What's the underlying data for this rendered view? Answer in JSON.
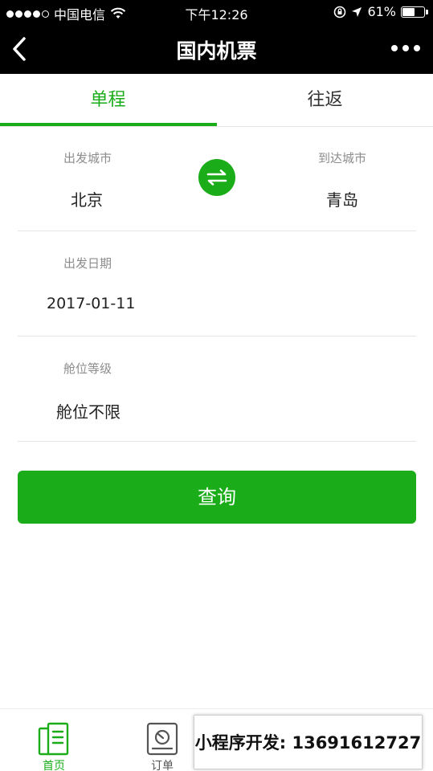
{
  "status_bar": {
    "carrier": "中国电信",
    "time": "下午12:26",
    "battery": "61%",
    "battery_level": 0.61
  },
  "nav": {
    "title": "国内机票"
  },
  "tabs": [
    {
      "label": "单程",
      "active": true
    },
    {
      "label": "往返",
      "active": false
    }
  ],
  "form": {
    "from_label": "出发城市",
    "from_value": "北京",
    "to_label": "到达城市",
    "to_value": "青岛",
    "date_label": "出发日期",
    "date_value": "2017-01-11",
    "class_label": "舱位等级",
    "class_value": "舱位不限"
  },
  "search_button": "查询",
  "tabbar": {
    "items": [
      {
        "label": "首页",
        "icon": "home-icon"
      },
      {
        "label": "订单",
        "icon": "order-icon"
      }
    ]
  },
  "overlay_ad": "小程序开发: 13691612727",
  "colors": {
    "accent": "#1aad19",
    "nav_bg": "#000000",
    "divider": "#e5e5e5",
    "label_gray": "#8c8c8c"
  }
}
